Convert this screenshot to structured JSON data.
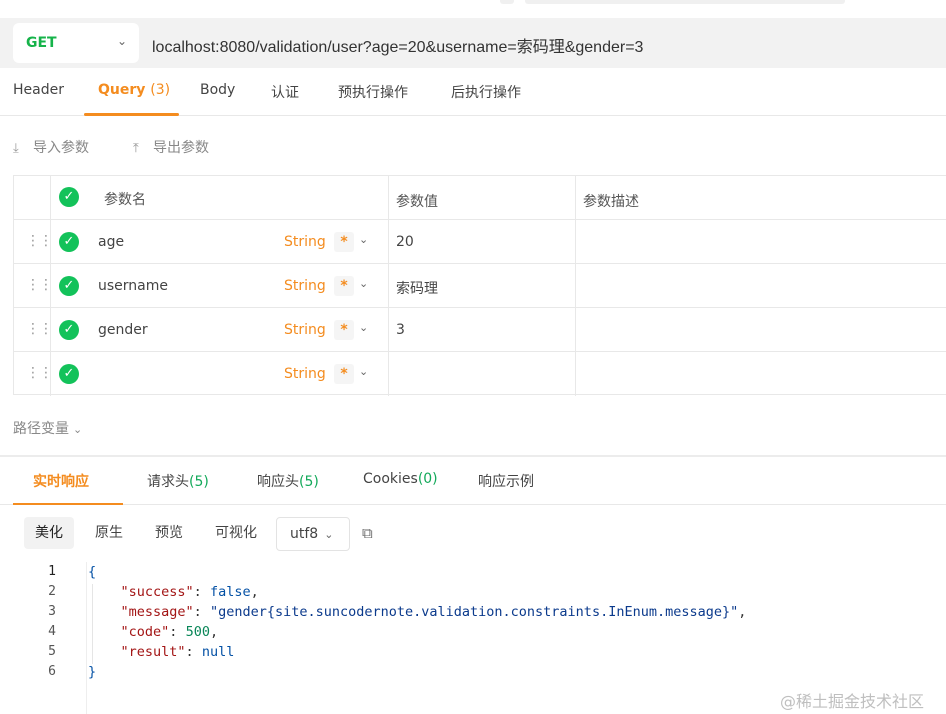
{
  "request": {
    "method": "GET",
    "url": "localhost:8080/validation/user?age=20&username=索码理&gender=3"
  },
  "req_tabs": [
    {
      "label": "Header",
      "count": ""
    },
    {
      "label": "Query",
      "count": "(3)"
    },
    {
      "label": "Body",
      "count": ""
    },
    {
      "label": "认证",
      "count": ""
    },
    {
      "label": "预执行操作",
      "count": ""
    },
    {
      "label": "后执行操作",
      "count": ""
    }
  ],
  "tools": {
    "import": "导入参数",
    "export": "导出参数"
  },
  "params": {
    "headers": {
      "name": "参数名",
      "value": "参数值",
      "desc": "参数描述"
    },
    "rows": [
      {
        "name": "age",
        "type": "String",
        "required": "*",
        "value": "20"
      },
      {
        "name": "username",
        "type": "String",
        "required": "*",
        "value": "索码理"
      },
      {
        "name": "gender",
        "type": "String",
        "required": "*",
        "value": "3"
      },
      {
        "name": "",
        "type": "String",
        "required": "*",
        "value": ""
      }
    ]
  },
  "path_vars": "路径变量",
  "res_tabs": [
    {
      "label": "实时响应",
      "count": ""
    },
    {
      "label": "请求头",
      "count": "(5)"
    },
    {
      "label": "响应头",
      "count": "(5)"
    },
    {
      "label": "Cookies",
      "count": "(0)"
    },
    {
      "label": "响应示例",
      "count": ""
    }
  ],
  "views": [
    "美化",
    "原生",
    "预览",
    "可视化"
  ],
  "encoding": "utf8",
  "code": {
    "line_numbers": [
      "1",
      "2",
      "3",
      "4",
      "5",
      "6"
    ],
    "open": "{",
    "close": "}",
    "entries": [
      {
        "key": "\"success\"",
        "value": "false",
        "vtype": "b",
        "comma": ","
      },
      {
        "key": "\"message\"",
        "value": "\"gender{site.suncodernote.validation.constraints.InEnum.message}\"",
        "vtype": "s",
        "comma": ","
      },
      {
        "key": "\"code\"",
        "value": "500",
        "vtype": "n",
        "comma": ","
      },
      {
        "key": "\"result\"",
        "value": "null",
        "vtype": "b",
        "comma": ""
      }
    ]
  },
  "watermark": "@稀土掘金技术社区"
}
